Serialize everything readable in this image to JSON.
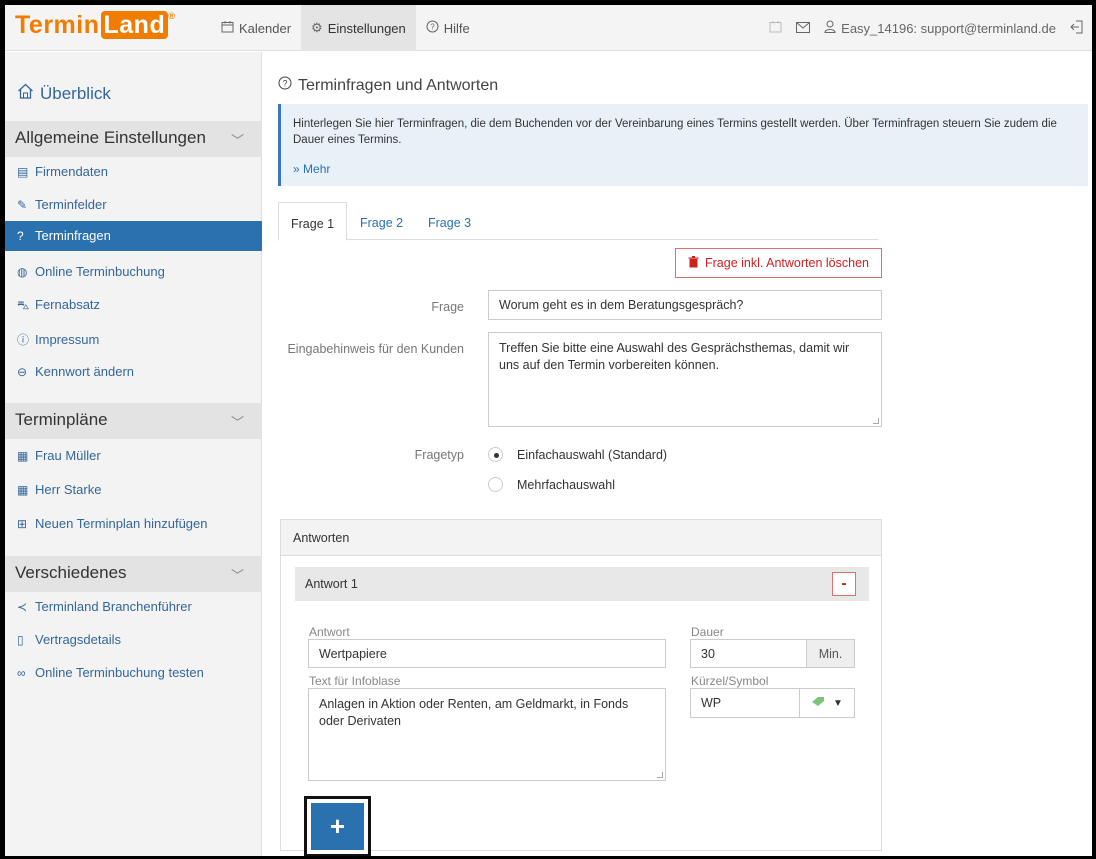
{
  "header": {
    "logo_prefix": "Termin",
    "logo_boxed": "Land",
    "logo_mark": "®",
    "nav": [
      {
        "icon": "calendar-icon",
        "label": "Kalender"
      },
      {
        "icon": "gear-icon",
        "label": "Einstellungen"
      },
      {
        "icon": "help-icon",
        "label": "Hilfe"
      }
    ],
    "account": "Easy_14196: support@terminland.de"
  },
  "sidebar": {
    "overview": "Überblick",
    "sections": [
      {
        "title": "Allgemeine Einstellungen",
        "items": [
          {
            "label": "Firmendaten"
          },
          {
            "label": "Terminfelder"
          },
          {
            "label": "Terminfragen",
            "active": true
          },
          {
            "label": "Online Terminbuchung"
          },
          {
            "label": "Fernabsatz"
          },
          {
            "label": "Impressum"
          },
          {
            "label": "Kennwort ändern"
          }
        ]
      },
      {
        "title": "Terminpläne",
        "items": [
          {
            "label": "Frau Müller"
          },
          {
            "label": "Herr Starke"
          },
          {
            "label": "Neuen Terminplan hinzufügen"
          }
        ]
      },
      {
        "title": "Verschiedenes",
        "items": [
          {
            "label": "Terminland Branchenführer"
          },
          {
            "label": "Vertragsdetails"
          },
          {
            "label": "Online Terminbuchung testen"
          }
        ]
      }
    ]
  },
  "main": {
    "title": "Terminfragen und Antworten",
    "info_text": "Hinterlegen Sie hier Terminfragen, die dem Buchenden vor der Vereinbarung eines Termins gestellt werden. Über Terminfragen steuern Sie zudem die Dauer eines Termins.",
    "info_more": "Mehr",
    "tabs": [
      "Frage 1",
      "Frage 2",
      "Frage 3"
    ],
    "delete_label": "Frage inkl. Antworten löschen",
    "question_label": "Frage",
    "question_value": "Worum geht es in dem Beratungsgespräch?",
    "hint_label": "Eingabehinweis für den Kunden",
    "hint_value": "Treffen Sie bitte eine Auswahl des Gesprächsthemas, damit wir uns auf den Termin vorbereiten können.",
    "type_label": "Fragetyp",
    "type_options": [
      "Einfachauswahl (Standard)",
      "Mehrfachauswahl"
    ],
    "type_selected": "Einfachauswahl (Standard)"
  },
  "answers": {
    "title": "Antworten",
    "answer_title": "Antwort 1",
    "remove_label": "-",
    "answer_label": "Antwort",
    "answer_value": "Wertpapiere",
    "duration_label": "Dauer",
    "duration_value": "30",
    "duration_unit": "Min.",
    "info_label": "Text für Infoblase",
    "info_value": "Anlagen in Aktion oder Renten, am Geldmarkt, in Fonds oder Derivaten",
    "symbol_label": "Kürzel/Symbol",
    "symbol_value": "WP",
    "add_label": "+"
  }
}
